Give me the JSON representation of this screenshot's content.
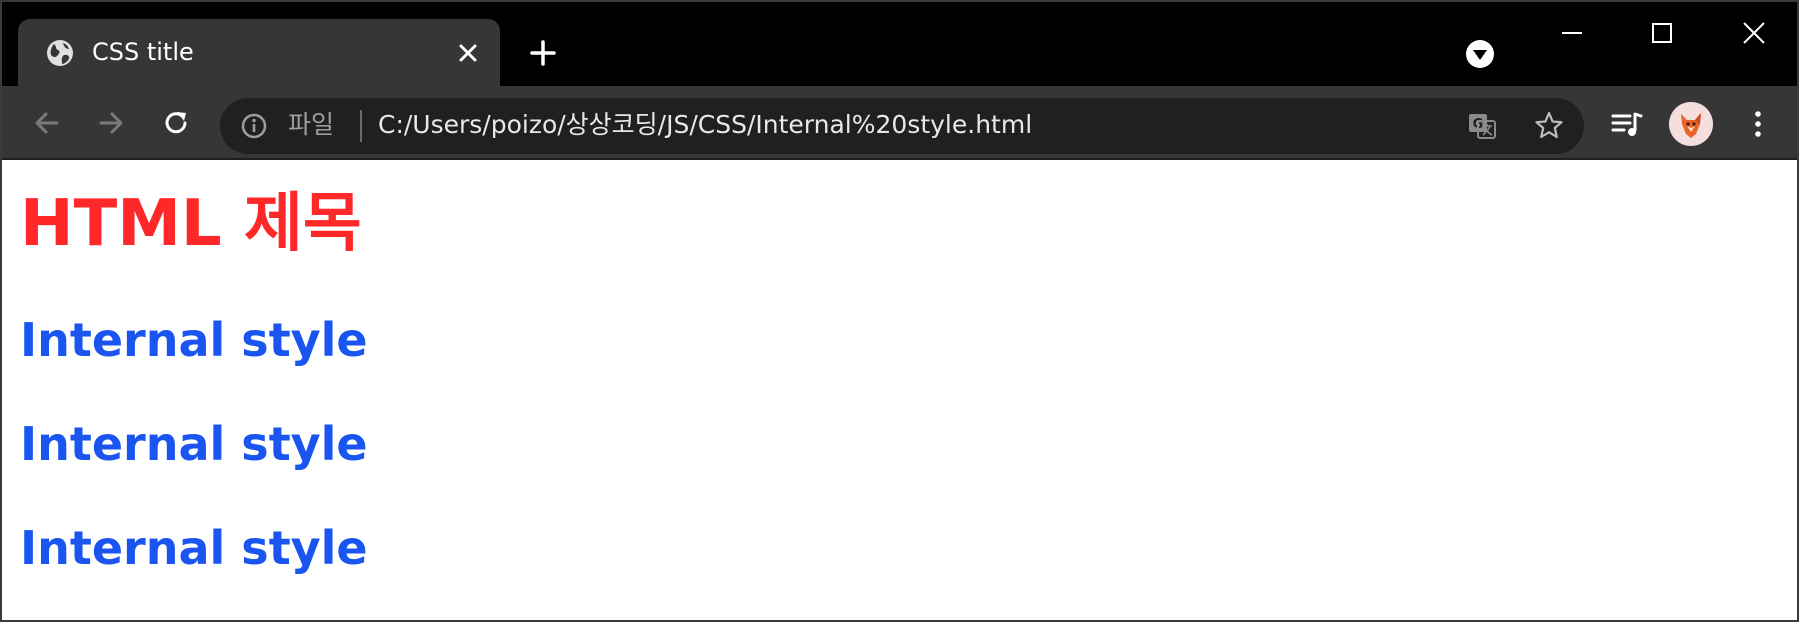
{
  "browser": {
    "tab": {
      "title": "CSS title",
      "favicon": "globe-icon"
    },
    "tab_controls": {
      "new_tab": "plus-icon",
      "tab_search": "chevron-down-circle-icon"
    },
    "window_controls": {
      "minimize": "minimize-icon",
      "maximize": "maximize-icon",
      "close": "close-icon"
    },
    "toolbar": {
      "back": "arrow-left-icon",
      "forward": "arrow-right-icon",
      "reload": "reload-icon"
    },
    "omnibox": {
      "scheme_label": "파일",
      "url": "C:/Users/poizo/상상코딩/JS/CSS/Internal%20style.html",
      "info_icon": "info-icon",
      "translate_icon": "translate-icon",
      "bookmark_icon": "star-icon"
    },
    "extensions": {
      "media": "media-queue-icon",
      "avatar": "fox-avatar",
      "menu": "kebab-menu-icon"
    },
    "colors": {
      "tabstrip_bg": "#000000",
      "tab_bg": "#363636",
      "omnibox_bg": "#202020"
    }
  },
  "page": {
    "heading": "HTML 제목",
    "subheadings": [
      "Internal style",
      "Internal style",
      "Internal style"
    ],
    "colors": {
      "heading": "#ff2828",
      "subheading": "#1a55f0"
    }
  }
}
